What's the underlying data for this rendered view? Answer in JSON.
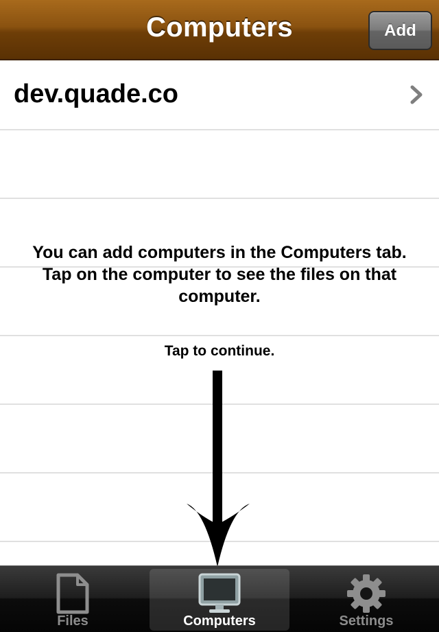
{
  "navbar": {
    "title": "Computers",
    "add_label": "Add",
    "gradient_top": "#a86a1c",
    "gradient_bottom": "#5a3104"
  },
  "computers": [
    {
      "name": "dev.quade.co",
      "icon": "chevron-right-icon"
    }
  ],
  "hint": {
    "message": "You can add computers in the Computers tab. Tap on the computer to see the files on that computer.",
    "continue": "Tap to continue."
  },
  "tabbar": {
    "tabs": [
      {
        "label": "Files",
        "icon": "file-icon",
        "selected": false
      },
      {
        "label": "Computers",
        "icon": "monitor-icon",
        "selected": true
      },
      {
        "label": "Settings",
        "icon": "gear-icon",
        "selected": false
      }
    ]
  }
}
